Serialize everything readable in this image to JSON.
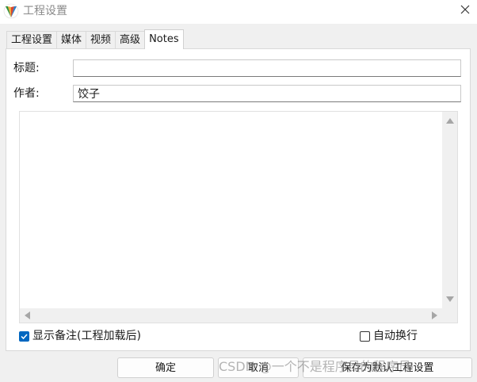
{
  "window": {
    "title": "工程设置",
    "icon": "reaper-logo-icon",
    "close_glyph": "✕"
  },
  "tabs": [
    {
      "label": "工程设置",
      "active": false
    },
    {
      "label": "媒体",
      "active": false
    },
    {
      "label": "视频",
      "active": false
    },
    {
      "label": "高级",
      "active": false
    },
    {
      "label": "Notes",
      "active": true
    }
  ],
  "notes": {
    "title_label": "标题:",
    "title_value": "",
    "author_label": "作者:",
    "author_value": "饺子",
    "body": ""
  },
  "options": {
    "show_notes_label": "显示备注(工程加载后)",
    "show_notes_checked": true,
    "word_wrap_label": "自动换行",
    "word_wrap_checked": false
  },
  "buttons": {
    "ok": "确定",
    "cancel": "取消",
    "save_default": "保存为默认工程设置"
  },
  "watermark": "CSDN @一个不是程序员的程序员",
  "colors": {
    "accent": "#0067c0",
    "window_bg": "#f0f0f0",
    "panel_bg": "#ffffff"
  }
}
